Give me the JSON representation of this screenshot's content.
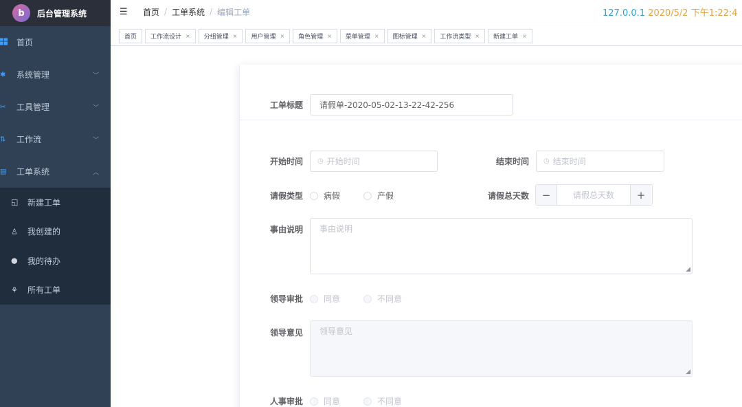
{
  "app": {
    "logo_letter": "b",
    "title": "后台管理系统"
  },
  "sidebar": {
    "items": [
      {
        "label": "首页",
        "icon": "dashboard-icon"
      },
      {
        "label": "系统管理",
        "icon": "gear-icon"
      },
      {
        "label": "工具管理",
        "icon": "tools-icon"
      },
      {
        "label": "工作流",
        "icon": "flow-icon"
      },
      {
        "label": "工单系统",
        "icon": "ticket-icon"
      }
    ],
    "submenu": [
      {
        "label": "新建工单",
        "icon": "new-ticket-icon"
      },
      {
        "label": "我创建的",
        "icon": "user-icon"
      },
      {
        "label": "我的待办",
        "icon": "chat-icon"
      },
      {
        "label": "所有工单",
        "icon": "grid-icon"
      }
    ]
  },
  "header": {
    "breadcrumb": [
      "首页",
      "工单系统",
      "编辑工单"
    ],
    "separator": "/",
    "host": "127.0.0.1",
    "datetime": "2020/5/2 下午1:22:4"
  },
  "tags": [
    "首页",
    "工作流设计",
    "分组管理",
    "用户管理",
    "角色管理",
    "菜单管理",
    "图标管理",
    "工作流类型",
    "新建工单"
  ],
  "form": {
    "title_label": "工单标题",
    "title_value": "请假单-2020-05-02-13-22-42-256",
    "start_label": "开始时间",
    "start_placeholder": "开始时间",
    "end_label": "结束时间",
    "end_placeholder": "结束时间",
    "leave_type_label": "请假类型",
    "leave_type_options": [
      "病假",
      "产假"
    ],
    "days_label": "请假总天数",
    "days_placeholder": "请假总天数",
    "reason_label": "事由说明",
    "reason_placeholder": "事由说明",
    "leader_approval_label": "领导审批",
    "approval_options": [
      "同意",
      "不同意"
    ],
    "leader_opinion_label": "领导意见",
    "leader_opinion_placeholder": "领导意见",
    "hr_approval_label": "人事审批"
  },
  "colors": {
    "sidebar_bg": "#304156",
    "submenu_bg": "#1f2d3d",
    "accent": "#409eff",
    "host": "#29a3d6",
    "datetime": "#e4a33c"
  }
}
